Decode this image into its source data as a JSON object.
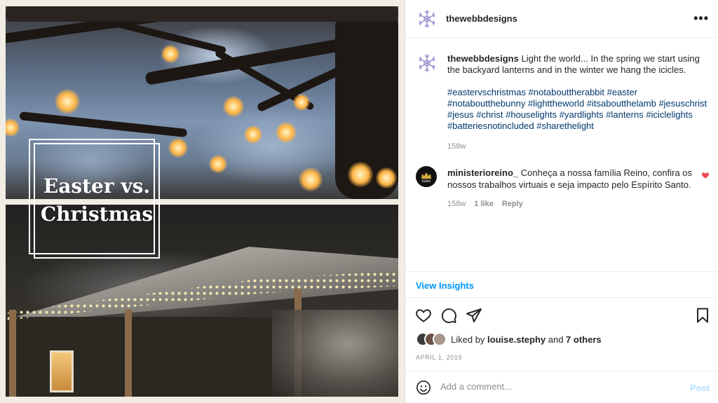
{
  "image": {
    "overlay_title_line1": "Easter vs.",
    "overlay_title_line2": "Christmas"
  },
  "post": {
    "username": "thewebbdesigns",
    "more_icon": "more-horizontal-icon",
    "caption": "Light the world... In the spring we start using the backyard lanterns and in the winter we hang the icicles.",
    "hashtags": [
      "#eastervschristmas",
      "#notabouttherabbit",
      "#easter",
      "#notaboutthebunny",
      "#lighttheworld",
      "#itsaboutthelamb",
      "#jesuschrist",
      "#jesus",
      "#christ",
      "#houselights",
      "#yardlights",
      "#lanterns",
      "#iciclelights",
      "#batteriesnotincluded",
      "#sharethelight"
    ],
    "caption_time": "158w"
  },
  "comment": {
    "username": "ministerioreino_",
    "text": "Conheça a nossa família Reino, confira os nossos trabalhos virtuais e seja impacto pelo Espírito Santo.",
    "time": "158w",
    "likes": "1 like",
    "reply": "Reply"
  },
  "insights_label": "View Insights",
  "likes": {
    "prefix": "Liked by ",
    "user": "louise.stephy",
    "and": " and ",
    "others": "7 others"
  },
  "date": "APRIL 1, 2019",
  "add_comment": {
    "placeholder": "Add a comment...",
    "post_label": "Post"
  },
  "colors": {
    "link_blue": "#00376b",
    "accent_blue": "#0095f6",
    "post_disabled": "#b2dffc",
    "heart_red": "#ed4956"
  }
}
